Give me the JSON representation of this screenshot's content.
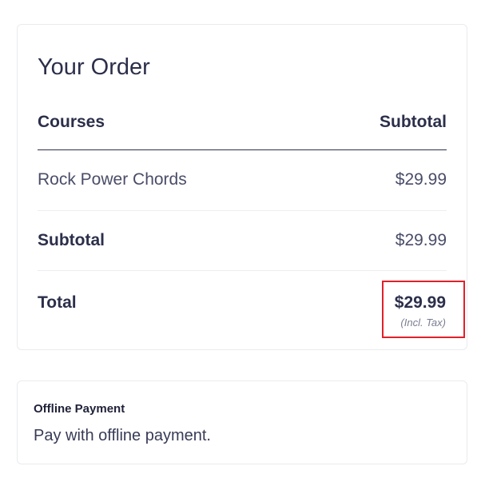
{
  "order": {
    "title": "Your Order",
    "columns": {
      "courses": "Courses",
      "subtotal": "Subtotal"
    },
    "items": [
      {
        "name": "Rock Power Chords",
        "price": "$29.99"
      }
    ],
    "subtotal": {
      "label": "Subtotal",
      "value": "$29.99"
    },
    "total": {
      "label": "Total",
      "value": "$29.99",
      "note": "(Incl. Tax)"
    }
  },
  "payment": {
    "method_title": "Offline Payment",
    "method_description": "Pay with offline payment."
  },
  "colors": {
    "highlight_border": "#e0212a",
    "text_dark": "#2c2f4a",
    "card_border": "#e9ebef"
  }
}
